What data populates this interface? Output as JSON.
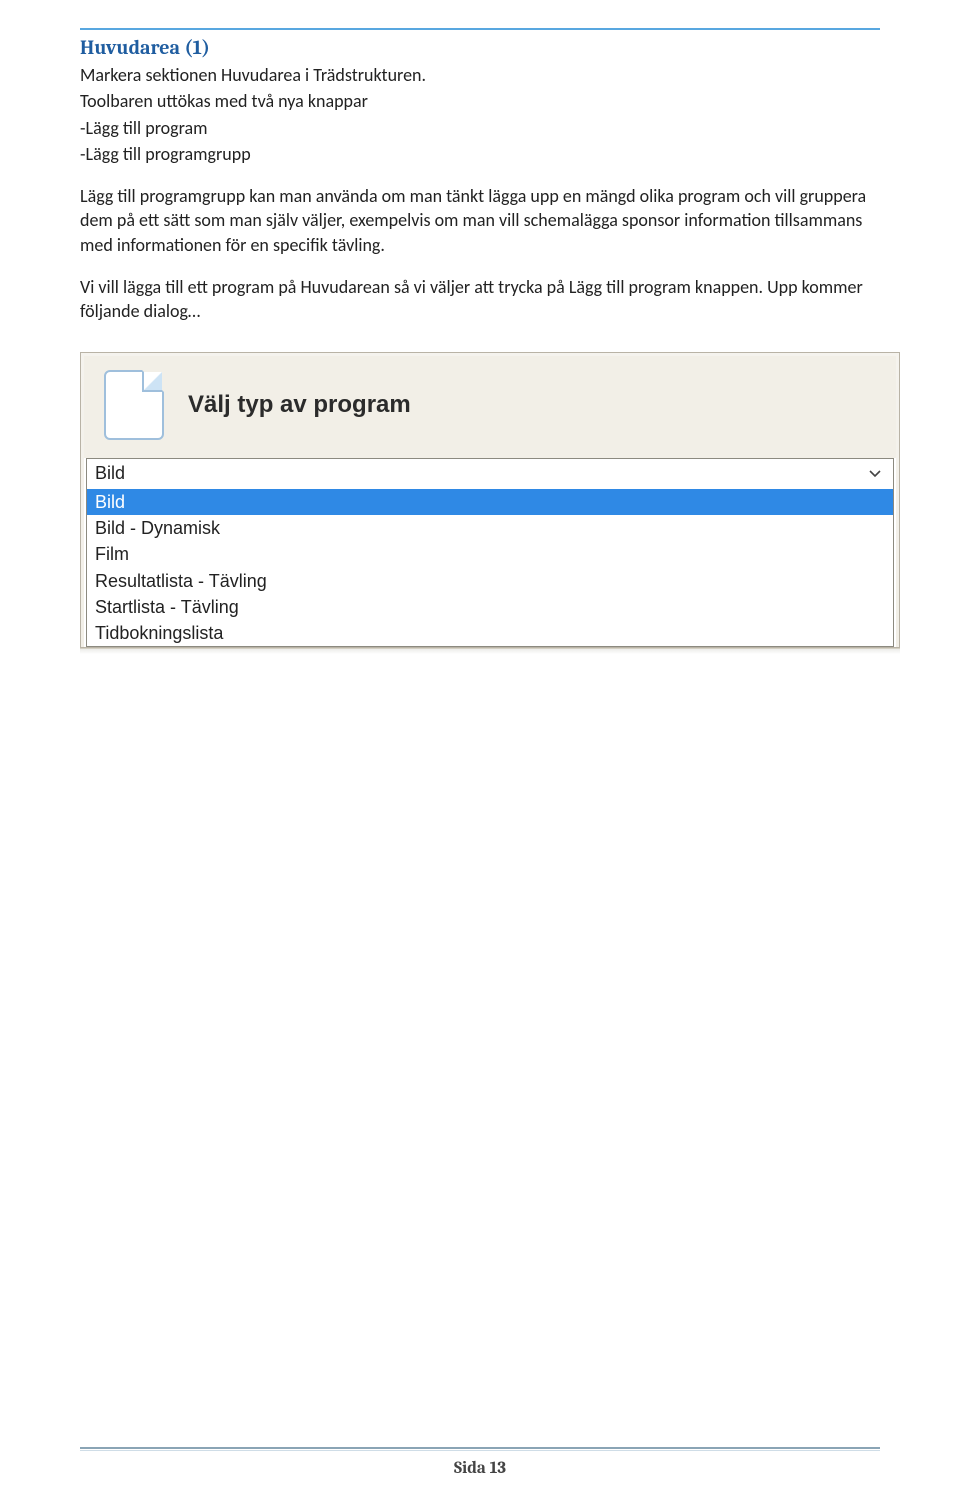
{
  "heading": "Huvudarea (1)",
  "paragraphs": {
    "p1": "Markera sektionen Huvudarea i Trädstrukturen.",
    "p2": "Toolbaren uttökas  med två nya knappar",
    "p3": "-Lägg till program",
    "p4": "-Lägg till programgrupp",
    "p5": "Lägg till programgrupp kan man använda om man tänkt lägga upp en mängd olika program och vill gruppera dem på ett sätt som man själv väljer, exempelvis om man vill schemalägga sponsor information tillsammans med informationen för en specifik tävling.",
    "p6": "Vi vill lägga till ett program på Huvudarean så vi väljer att trycka på Lägg till program knappen.  Upp kommer följande dialog…"
  },
  "dialog": {
    "title": "Välj typ av program",
    "selected": "Bild",
    "options": [
      "Bild",
      "Bild - Dynamisk",
      "Film",
      "Resultatlista - Tävling",
      "Startlista - Tävling",
      "Tidbokningslista"
    ]
  },
  "footer": "Sida 13"
}
